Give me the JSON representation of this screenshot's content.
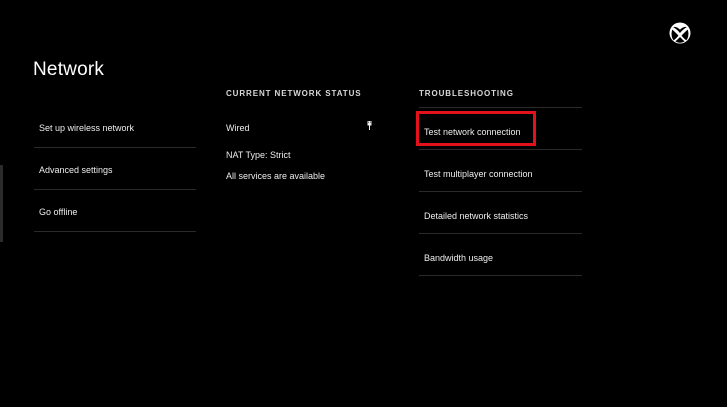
{
  "page": {
    "title": "Network"
  },
  "left_menu": {
    "items": [
      {
        "label": "Set up wireless network"
      },
      {
        "label": "Advanced settings"
      },
      {
        "label": "Go offline"
      }
    ]
  },
  "status": {
    "header": "CURRENT NETWORK STATUS",
    "connection_type": "Wired",
    "connection_icon": "ethernet-plug-icon",
    "nat_type": "NAT Type: Strict",
    "services": "All services are available"
  },
  "troubleshooting": {
    "header": "TROUBLESHOOTING",
    "items": [
      {
        "label": "Test network connection"
      },
      {
        "label": "Test multiplayer connection"
      },
      {
        "label": "Detailed network statistics"
      },
      {
        "label": "Bandwidth usage"
      }
    ],
    "highlighted_item": "Test network connection"
  },
  "colors": {
    "background": "#000000",
    "text": "#ededed",
    "divider": "#2a2a2a",
    "highlight": "#e3111b"
  },
  "logo": {
    "icon": "xbox-logo-icon"
  }
}
